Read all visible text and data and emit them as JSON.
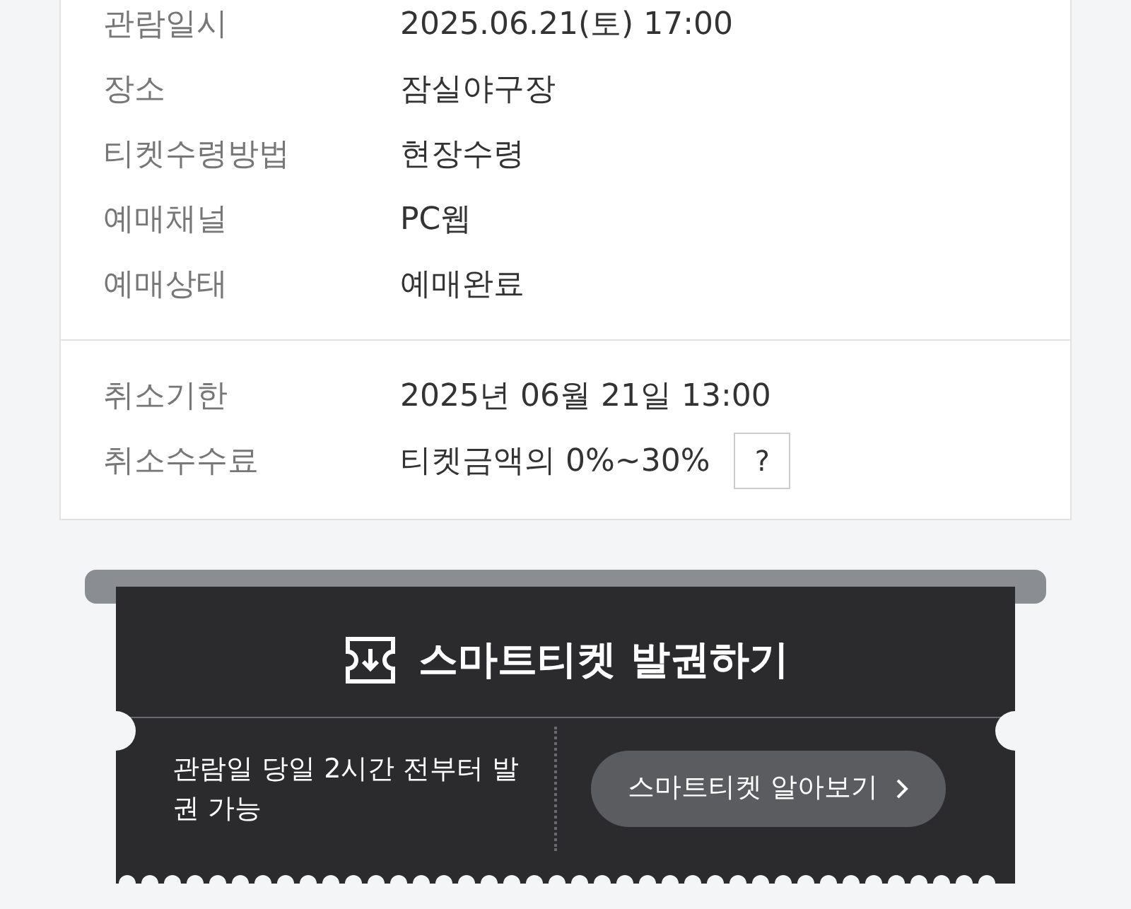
{
  "details": [
    {
      "label": "관람일시",
      "value": "2025.06.21(토) 17:00"
    },
    {
      "label": "장소",
      "value": "잠실야구장"
    },
    {
      "label": "티켓수령방법",
      "value": "현장수령"
    },
    {
      "label": "예매채널",
      "value": "PC웹"
    },
    {
      "label": "예매상태",
      "value": "예매완료"
    }
  ],
  "cancellation": [
    {
      "label": "취소기한",
      "value": "2025년 06월 21일 13:00"
    },
    {
      "label": "취소수수료",
      "value": "티켓금액의 0%~30%",
      "help": "?"
    }
  ],
  "smart_ticket": {
    "title": "스마트티켓 발권하기",
    "note": "관람일 당일 2시간 전부터 발권 가능",
    "button": "스마트티켓 알아보기"
  }
}
